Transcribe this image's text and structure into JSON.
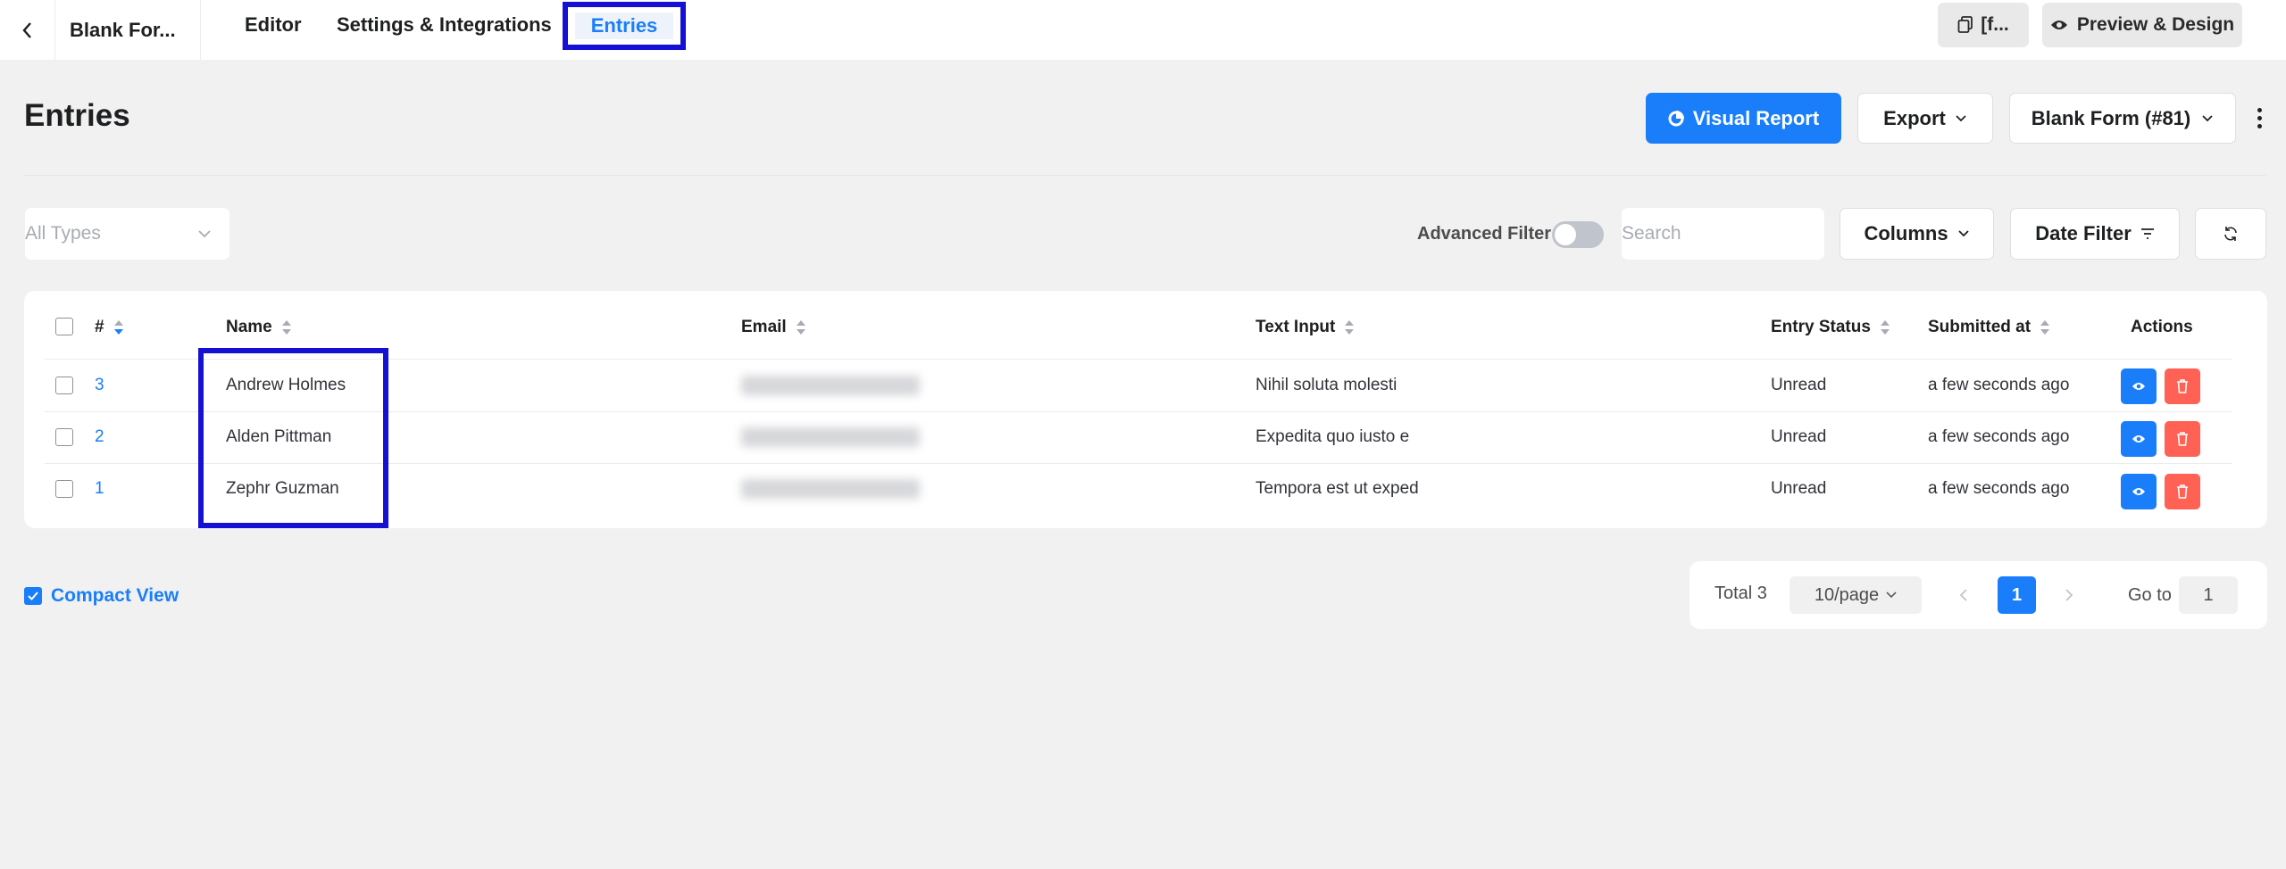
{
  "topbar": {
    "form_name": "Blank For...",
    "tabs": [
      {
        "label": "Editor"
      },
      {
        "label": "Settings & Integrations"
      },
      {
        "label": "Entries"
      }
    ],
    "shortcode_label": "[f...",
    "preview_label": "Preview & Design"
  },
  "header": {
    "title": "Entries",
    "visual_report": "Visual Report",
    "export": "Export",
    "form_select": "Blank Form (#81)"
  },
  "filters": {
    "types_placeholder": "All Types",
    "advanced_filter": "Advanced Filter",
    "search_placeholder": "Search",
    "columns": "Columns",
    "date_filter": "Date Filter"
  },
  "table": {
    "headers": {
      "id": "#",
      "name": "Name",
      "email": "Email",
      "text_input": "Text Input",
      "status": "Entry Status",
      "submitted": "Submitted at",
      "actions": "Actions"
    },
    "rows": [
      {
        "id": "3",
        "name": "Andrew Holmes",
        "text": "Nihil soluta molesti",
        "status": "Unread",
        "submitted": "a few seconds ago"
      },
      {
        "id": "2",
        "name": "Alden Pittman",
        "text": "Expedita quo iusto e",
        "status": "Unread",
        "submitted": "a few seconds ago"
      },
      {
        "id": "1",
        "name": "Zephr Guzman",
        "text": "Tempora est ut exped",
        "status": "Unread",
        "submitted": "a few seconds ago"
      }
    ]
  },
  "footer": {
    "compact_view": "Compact View",
    "total": "Total 3",
    "page_size": "10/page",
    "current_page": "1",
    "goto_label": "Go to",
    "goto_value": "1"
  },
  "colors": {
    "accent": "#1a7efb",
    "danger": "#ff6154",
    "highlight": "#1410d4"
  }
}
